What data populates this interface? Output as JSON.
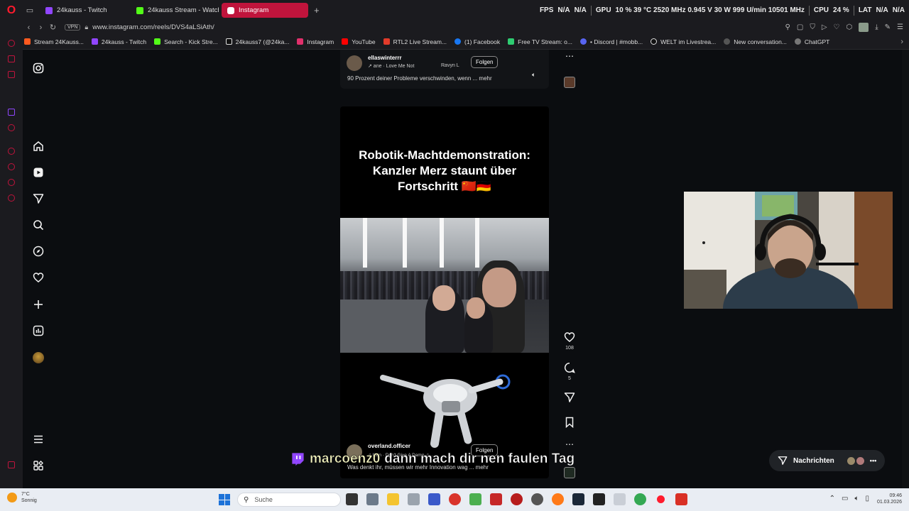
{
  "browser": {
    "tabs": [
      {
        "label": "24kauss - Twitch",
        "color": "#9146ff"
      },
      {
        "label": "24kauss Stream - Watch L",
        "color": "#53fc18"
      },
      {
        "label": "Instagram",
        "color": "#e1306c",
        "active": true
      }
    ],
    "stats": {
      "fps_label": "FPS",
      "fps_value": "N/A",
      "fps_value2": "N/A",
      "gpu_label": "GPU",
      "gpu_value": "10 % 39 °C 2520 MHz 0.945 V 30 W 999 U/min 10501 MHz",
      "cpu_label": "CPU",
      "cpu_value": "24 %",
      "lat_label": "LAT",
      "lat_value": "N/A",
      "lat_value2": "N/A"
    },
    "vpn_label": "VPN",
    "url": "www.instagram.com/reels/DVS4aLSiAth/",
    "bookmarks": [
      {
        "label": "Stream 24Kauss...",
        "color": "#ff5a1f"
      },
      {
        "label": "24kauss - Twitch",
        "color": "#9146ff"
      },
      {
        "label": "Search - Kick Stre...",
        "color": "#53fc18"
      },
      {
        "label": "24kauss7 (@24ka...",
        "color": "#111111"
      },
      {
        "label": "Instagram",
        "color": "#e1306c"
      },
      {
        "label": "YouTube",
        "color": "#ff0000"
      },
      {
        "label": "RTL2 Live Stream...",
        "color": "#e23b2a"
      },
      {
        "label": "(1) Facebook",
        "color": "#1877f2"
      },
      {
        "label": "Free TV Stream: o...",
        "color": "#2ecc71"
      },
      {
        "label": "• Discord | #mobb...",
        "color": "#5865f2"
      },
      {
        "label": "WELT im Livestrea...",
        "color": "#111111"
      },
      {
        "label": "New conversation...",
        "color": "#555555"
      },
      {
        "label": "ChatGPT",
        "color": "#777777"
      }
    ]
  },
  "reels": {
    "top": {
      "username": "ellaswinterrr",
      "music": "↗  ane · Love Me Not",
      "music2": "Ravyn L",
      "follow_label": "Folgen",
      "caption": "90 Prozent deiner Probleme verschwinden, wenn ...  mehr"
    },
    "main": {
      "title_line1": "Robotik-Machtdemonstration:",
      "title_line2": "Kanzler Merz staunt über",
      "title_line3": "Fortschritt 🇨🇳🇩🇪",
      "username": "overland.officer",
      "music": "♫ Ikon · Don't Give A Damn  ♫ ...",
      "follow_label": "Folgen",
      "caption": "Was denkt ihr, müssen wir mehr Innovation wag ...  mehr"
    },
    "actions": {
      "likes": "108",
      "comments": "5"
    }
  },
  "chat_overlay": {
    "user": "marcoenz0",
    "message": "dann mach dir nen faulen Tag"
  },
  "messages_label": "Nachrichten",
  "taskbar": {
    "weather_temp": "7°C",
    "weather_desc": "Sonnig",
    "search_placeholder": "Suche",
    "time": "09:46",
    "date": "01.03.2026"
  }
}
